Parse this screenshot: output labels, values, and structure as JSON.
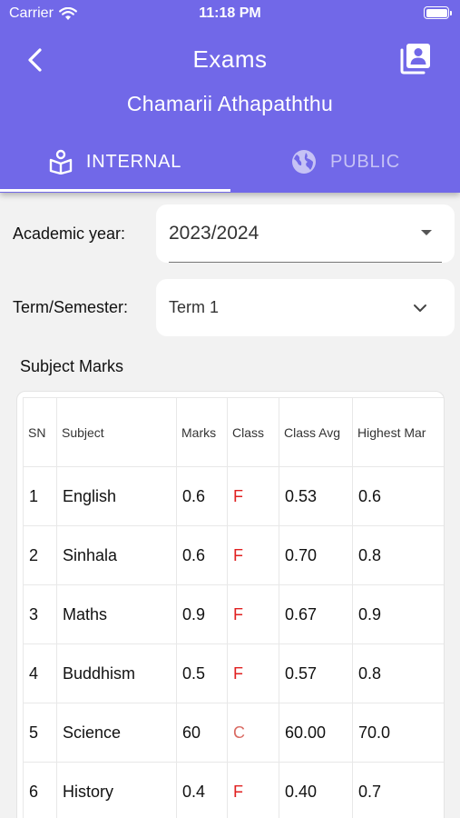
{
  "status_bar": {
    "carrier": "Carrier",
    "time": "11:18 PM"
  },
  "header": {
    "title": "Exams",
    "student_name": "Chamarii Athapaththu"
  },
  "tabs": [
    {
      "label": "INTERNAL",
      "icon": "book-reader-icon",
      "selected": true
    },
    {
      "label": "PUBLIC",
      "icon": "globe-icon",
      "selected": false
    }
  ],
  "filters": {
    "academic_year": {
      "label": "Academic year:",
      "value": "2023/2024"
    },
    "term": {
      "label": "Term/Semester:",
      "value": "Term 1"
    }
  },
  "subject_marks": {
    "title": "Subject Marks",
    "columns": [
      "SN",
      "Subject",
      "Marks",
      "Class",
      "Class Avg",
      "Highest Mar"
    ],
    "rows": [
      [
        "1",
        "English",
        "0.6",
        "F",
        "0.53",
        "0.6"
      ],
      [
        "2",
        "Sinhala",
        "0.6",
        "F",
        "0.70",
        "0.8"
      ],
      [
        "3",
        "Maths",
        "0.9",
        "F",
        "0.67",
        "0.9"
      ],
      [
        "4",
        "Buddhism",
        "0.5",
        "F",
        "0.57",
        "0.8"
      ],
      [
        "5",
        "Science",
        "60",
        "C",
        "60.00",
        "70.0"
      ],
      [
        "6",
        "History",
        "0.4",
        "F",
        "0.40",
        "0.7"
      ]
    ]
  },
  "colors": {
    "header": "#7168e8",
    "fail_grade": "#e02020",
    "grade_c": "#d96a62",
    "background": "#f2f2f2"
  }
}
